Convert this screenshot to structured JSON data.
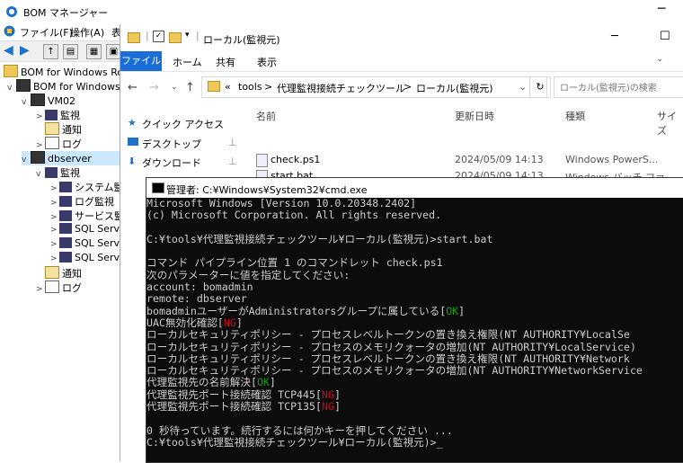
{
  "bom": {
    "title": "BOM マネージャー",
    "menu": [
      "ファイル(F)",
      "操作(A)",
      "表"
    ],
    "tree": {
      "root": "BOM for Windows Root",
      "root_child": "BOM for Windows V",
      "vm02": "VM02",
      "vm02_children": [
        "監視",
        "通知",
        "ログ"
      ],
      "dbserver": "dbserver",
      "db_monitor": "監視",
      "db_monitor_children": [
        "システム監",
        "ログ監視",
        "サービス監",
        "SQL Serve",
        "SQL Serve",
        "SQL Serve"
      ],
      "db_notify": "通知",
      "db_log": "ログ"
    }
  },
  "explorer": {
    "title_path": "ローカル(監視元)",
    "tabs": {
      "file": "ファイル",
      "home": "ホーム",
      "share": "共有",
      "view": "表示"
    },
    "address": [
      "«",
      "tools",
      ">",
      "代理監視接続チェックツール",
      ">",
      "ローカル(監視元)"
    ],
    "search_placeholder": "ローカル(監視元)の検索",
    "nav": {
      "quick": "クイック アクセス",
      "desktop": "デスクトップ",
      "downloads": "ダウンロード"
    },
    "columns": {
      "name": "名前",
      "date": "更新日時",
      "type": "種類",
      "size": "サイズ"
    },
    "files": [
      {
        "name": "check.ps1",
        "date": "2024/05/09 14:13",
        "type": "Windows PowerS..."
      },
      {
        "name": "start.bat",
        "date": "2024/05/09 14:13",
        "type": "Windows バッチ ファ..."
      }
    ]
  },
  "cmd": {
    "title": "管理者: C:¥Windows¥System32¥cmd.exe",
    "lines": [
      {
        "t": "Microsoft Windows [Version 10.0.20348.2402]"
      },
      {
        "t": "(c) Microsoft Corporation. All rights reserved."
      },
      {
        "t": ""
      },
      {
        "t": "C:¥tools¥代理監視接続チェックツール¥ローカル(監視元)>start.bat"
      },
      {
        "t": ""
      },
      {
        "t": "コマンド パイプライン位置 1 のコマンドレット check.ps1"
      },
      {
        "t": "次のパラメーターに値を指定してください:"
      },
      {
        "t": "account: bomadmin"
      },
      {
        "t": "remote: dbserver"
      },
      {
        "t": "bomadminユーザーがAdministratorsグループに属している",
        "tag": "OK"
      },
      {
        "t": "UAC無効化確認",
        "tag": "NG"
      },
      {
        "t": "ローカルセキュリティポリシー - プロセスレベルトークンの置き換え権限(NT AUTHORITY¥LocalSe"
      },
      {
        "t": "ローカルセキュリティポリシー - プロセスのメモリクォータの増加(NT AUTHORITY¥LocalService)"
      },
      {
        "t": "ローカルセキュリティポリシー - プロセスレベルトークンの置き換え権限(NT AUTHORITY¥Network"
      },
      {
        "t": "ローカルセキュリティポリシー - プロセスのメモリクォータの増加(NT AUTHORITY¥NetworkService"
      },
      {
        "t": "代理監視先の名前解決",
        "tag": "OK"
      },
      {
        "t": "代理監視先ポート接続確認 TCP445",
        "tag": "NG"
      },
      {
        "t": "代理監視先ポート接続確認 TCP135",
        "tag": "NG"
      },
      {
        "t": ""
      },
      {
        "t": "0 秒待っています。続行するには何かキーを押してください ..."
      },
      {
        "t": "C:¥tools¥代理監視接続チェックツール¥ローカル(監視元)>_"
      }
    ]
  }
}
